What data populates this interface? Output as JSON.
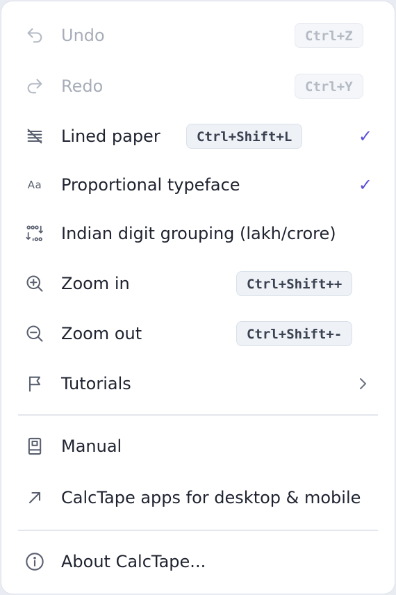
{
  "menu": {
    "items": [
      {
        "label": "Undo",
        "shortcut": "Ctrl+Z",
        "icon": "undo-icon",
        "disabled": true
      },
      {
        "label": "Redo",
        "shortcut": "Ctrl+Y",
        "icon": "redo-icon",
        "disabled": true
      },
      {
        "label": "Lined paper",
        "shortcut": "Ctrl+Shift+L",
        "icon": "lined-paper-icon",
        "checked": true
      },
      {
        "label": "Proportional typeface",
        "icon": "typeface-icon",
        "icon_text": "Aa",
        "checked": true
      },
      {
        "label": "Indian digit grouping (lakh/crore)",
        "icon": "digit-grouping-icon",
        "checked": false
      },
      {
        "label": "Zoom in",
        "shortcut": "Ctrl+Shift++",
        "icon": "zoom-in-icon"
      },
      {
        "label": "Zoom out",
        "shortcut": "Ctrl+Shift+-",
        "icon": "zoom-out-icon"
      },
      {
        "label": "Tutorials",
        "icon": "flag-icon",
        "submenu": true
      },
      {
        "label": "Manual",
        "icon": "book-icon"
      },
      {
        "label": "CalcTape apps for desktop & mobile",
        "icon": "external-arrow-icon"
      },
      {
        "label": "About CalcTape...",
        "icon": "info-icon"
      }
    ],
    "check_glyph": "✓"
  },
  "colors": {
    "accent": "#5a4fd6",
    "text": "#1f2330",
    "disabled_text": "#a7adb8",
    "icon": "#5a6070"
  }
}
